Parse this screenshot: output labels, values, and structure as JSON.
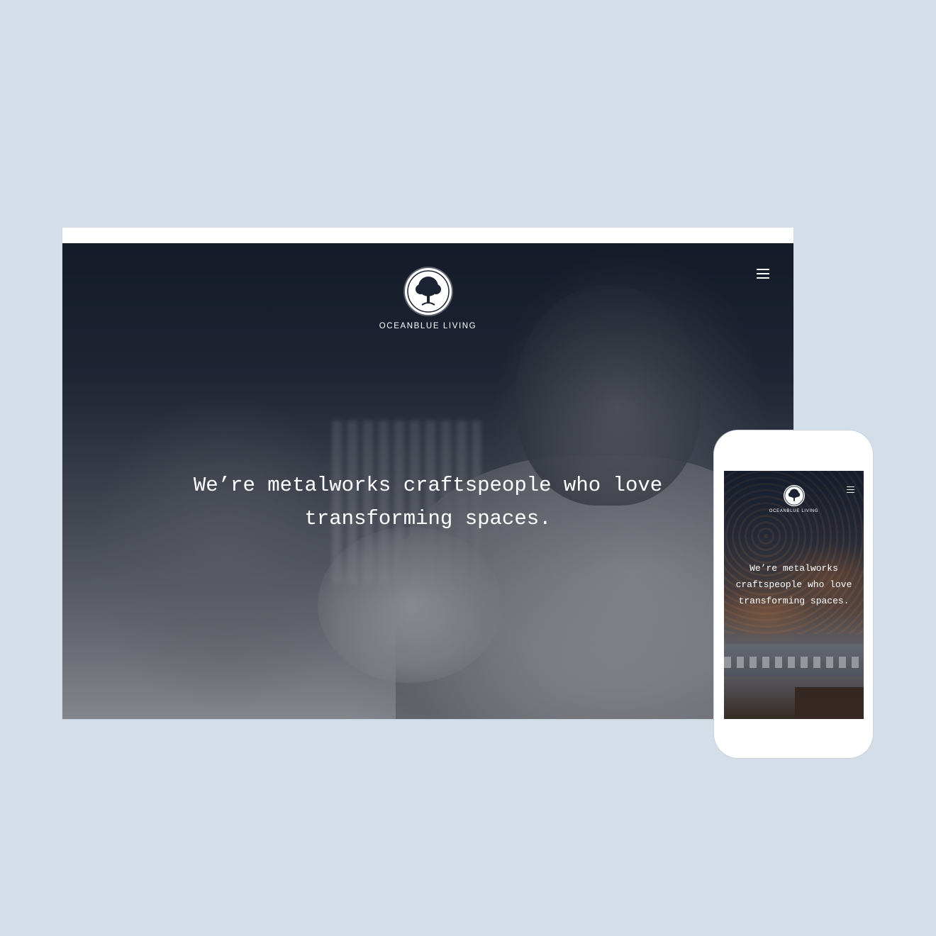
{
  "brand": {
    "name": "OCEANBLUE LIVING",
    "logo_icon": "tree-logo-icon"
  },
  "desktop": {
    "menu_icon": "hamburger-menu-icon",
    "headline": "We’re metalworks craftspeople who love transforming spaces."
  },
  "mobile": {
    "menu_icon": "hamburger-menu-icon",
    "headline": "We’re metalworks craftspeople who love transforming spaces."
  },
  "colors": {
    "background": "#d4dee9",
    "hero_overlay": "#1c2332",
    "text": "#ffffff"
  }
}
